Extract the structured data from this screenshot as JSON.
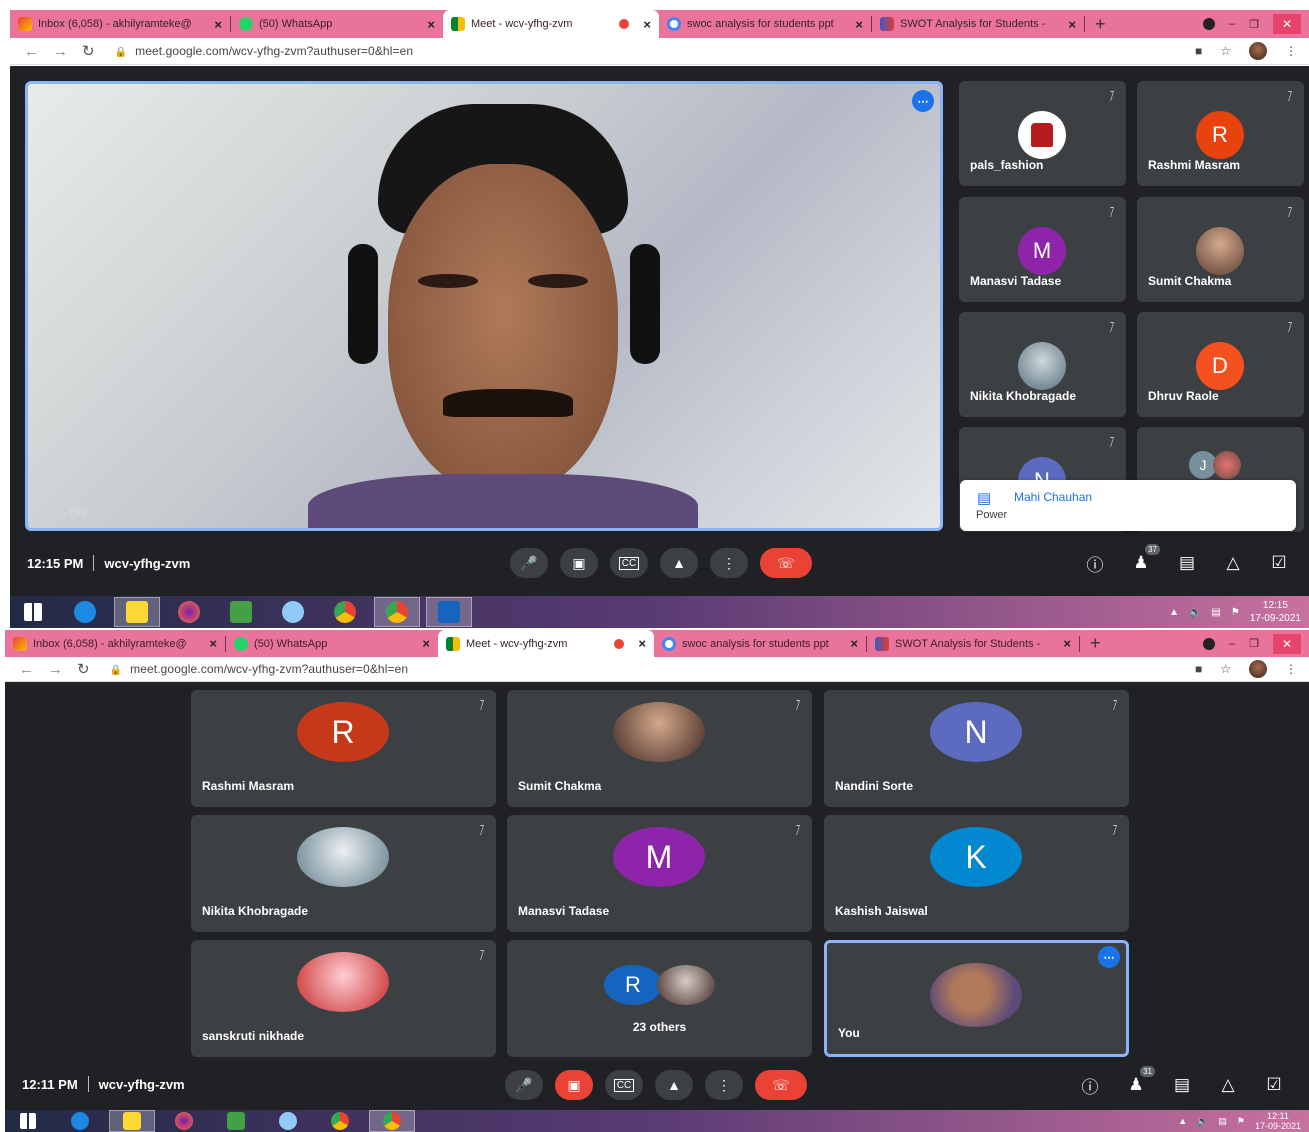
{
  "tabs": [
    {
      "title": "Inbox (6,058) - akhilyramteke@",
      "favicon": "gmail-icon",
      "color": "#ea4335"
    },
    {
      "title": "(50) WhatsApp",
      "favicon": "whatsapp-icon",
      "color": "#25d366"
    },
    {
      "title": "Meet - wcv-yfhg-zvm",
      "favicon": "meet-icon",
      "color": "#00832d",
      "active": true
    },
    {
      "title": "swoc analysis for students ppt",
      "favicon": "google-icon",
      "color": "#4285f4"
    },
    {
      "title": "SWOT Analysis for Students - ",
      "favicon": "bow-tie-icon",
      "color": "#3a5bbf"
    }
  ],
  "browser": {
    "url": "meet.google.com/wcv-yfhg-zvm?authuser=0&hl=en",
    "new_tab": "+",
    "close_glyph": "×"
  },
  "screen1": {
    "main_video_label": "You",
    "tiles": [
      {
        "name": "pals_fashion",
        "avatar": "logo",
        "color": "#ffffff"
      },
      {
        "name": "Rashmi Masram",
        "avatar": "R",
        "color": "#e8430e"
      },
      {
        "name": "Manasvi Tadase",
        "avatar": "M",
        "color": "#8e24aa"
      },
      {
        "name": "Sumit Chakma",
        "avatar": "photo",
        "color": "#6d4c41"
      },
      {
        "name": "Nikita Khobragade",
        "avatar": "photo",
        "color": "#78909c"
      },
      {
        "name": "Dhruv Raole",
        "avatar": "D",
        "color": "#f4511e"
      },
      {
        "name": "",
        "avatar": "N",
        "color": "#5c6bc0"
      },
      {
        "name": "",
        "avatar": "J",
        "color": "#78909c"
      }
    ],
    "popup": {
      "name": "Mahi Chauhan",
      "subtitle": "Power"
    },
    "time": "12:15 PM",
    "meeting_code": "wcv-yfhg-zvm",
    "participants_count": "37",
    "clock_time": "12:15",
    "clock_date": "17-09-2021"
  },
  "screen2": {
    "tiles": [
      {
        "name": "Rashmi Masram",
        "avatar": "R",
        "color": "#c5391a"
      },
      {
        "name": "Sumit Chakma",
        "avatar": "photo",
        "color": "#5d4037"
      },
      {
        "name": "Nandini Sorte",
        "avatar": "N",
        "color": "#5c6bc0"
      },
      {
        "name": "Nikita Khobragade",
        "avatar": "photo",
        "color": "#90a4ae"
      },
      {
        "name": "Manasvi Tadase",
        "avatar": "M",
        "color": "#8e24aa"
      },
      {
        "name": "Kashish Jaiswal",
        "avatar": "K",
        "color": "#0288d1"
      },
      {
        "name": "sanskruti nikhade",
        "avatar": "photo",
        "color": "#e57373"
      },
      {
        "name": "23 others",
        "avatar": "R",
        "color": "#1565c0"
      },
      {
        "name": "You",
        "avatar": "photo",
        "color": "#6d4c41"
      }
    ],
    "time": "12:11 PM",
    "meeting_code": "wcv-yfhg-zvm",
    "participants_count": "31",
    "clock_time": "12:11",
    "clock_date": "17-09-2021"
  }
}
